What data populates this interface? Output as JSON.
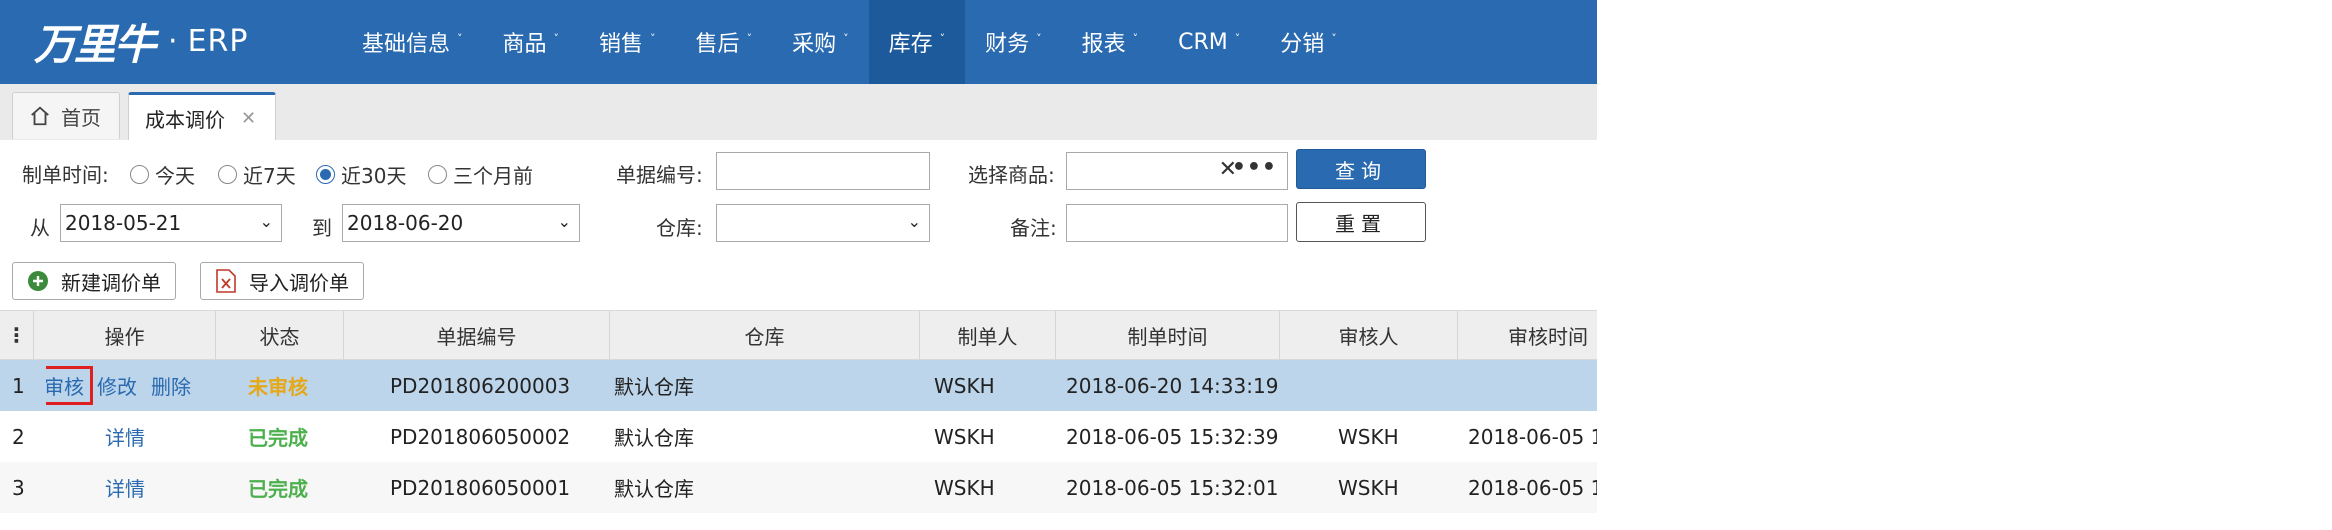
{
  "header": {
    "logo_text": "万里牛",
    "logo_dot": "·",
    "logo_suffix": "ERP",
    "nav": [
      {
        "label": "基础信息"
      },
      {
        "label": "商品"
      },
      {
        "label": "销售"
      },
      {
        "label": "售后"
      },
      {
        "label": "采购"
      },
      {
        "label": "库存",
        "active": true
      },
      {
        "label": "财务"
      },
      {
        "label": "报表"
      },
      {
        "label": "CRM"
      },
      {
        "label": "分销"
      }
    ],
    "nav_caret": "˅",
    "colors": {
      "bar": "#2a6ab0",
      "active": "#1d5a9b"
    }
  },
  "tabs": {
    "home": "首页",
    "current": "成本调价",
    "close_glyph": "✕"
  },
  "filter": {
    "time_label": "制单时间:",
    "time_options": [
      "今天",
      "近7天",
      "近30天",
      "三个月前"
    ],
    "time_selected": "近30天",
    "from_label": "从",
    "from_value": "2018-05-21",
    "to_label": "到",
    "to_value": "2018-06-20",
    "doc_no_label": "单据编号:",
    "doc_no_value": "",
    "warehouse_label": "仓库:",
    "warehouse_value": "",
    "product_label": "选择商品:",
    "product_value": "",
    "product_clear": "✕",
    "product_more": "•••",
    "remark_label": "备注:",
    "remark_value": "",
    "query_button": "查询",
    "reset_button": "重置"
  },
  "toolbar": {
    "new_button": "新建调价单",
    "import_button": "导入调价单"
  },
  "grid": {
    "menu_glyph": "⋮",
    "columns": [
      "操作",
      "状态",
      "单据编号",
      "仓库",
      "制单人",
      "制单时间",
      "审核人",
      "审核时间"
    ],
    "rows": [
      {
        "no": "1",
        "actions": [
          "审核",
          "修改",
          "删除"
        ],
        "status": "未审核",
        "doc_no": "PD201806200003",
        "warehouse": "默认仓库",
        "creator": "WSKH",
        "created": "2018-06-20 14:33:19",
        "auditor": "",
        "audited": ""
      },
      {
        "no": "2",
        "actions": [
          "详情"
        ],
        "status": "已完成",
        "doc_no": "PD201806050002",
        "warehouse": "默认仓库",
        "creator": "WSKH",
        "created": "2018-06-05 15:32:39",
        "auditor": "WSKH",
        "audited": "2018-06-05 1"
      },
      {
        "no": "3",
        "actions": [
          "详情"
        ],
        "status": "已完成",
        "doc_no": "PD201806050001",
        "warehouse": "默认仓库",
        "creator": "WSKH",
        "created": "2018-06-05 15:32:01",
        "auditor": "WSKH",
        "audited": "2018-06-05 1"
      }
    ],
    "status_colors": {
      "未审核": "#e6a817",
      "已完成": "#4cb04c"
    },
    "selected_row": "1",
    "highlighted_action": "审核"
  }
}
